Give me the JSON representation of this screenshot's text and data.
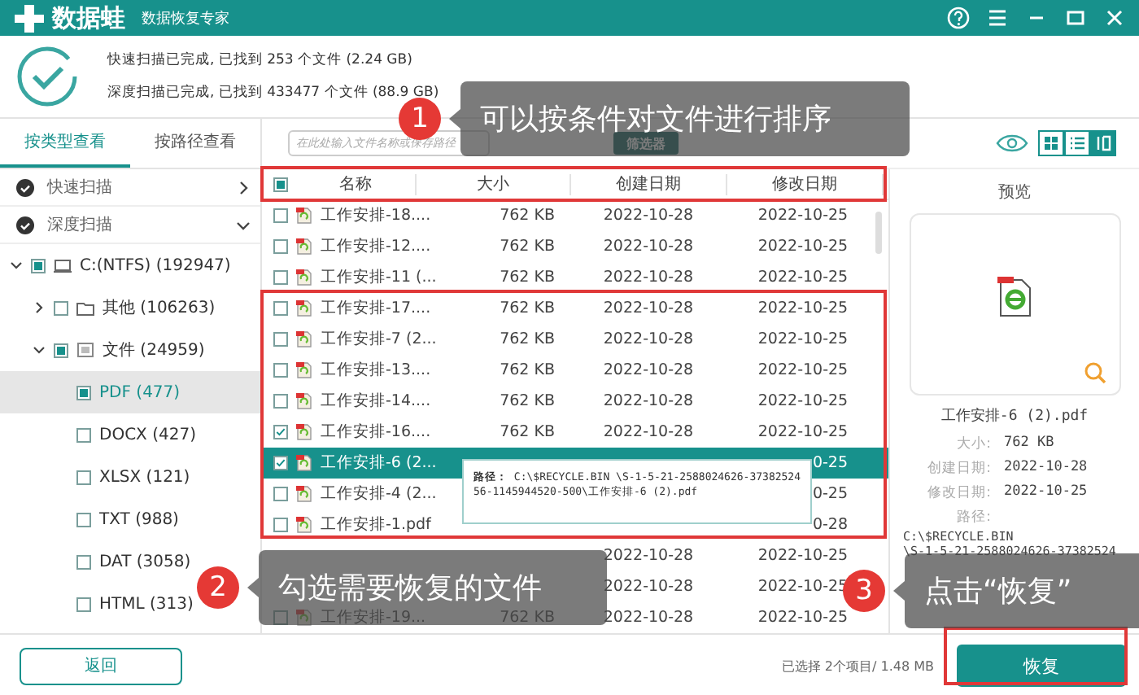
{
  "window": {
    "app_name": "数据蛙",
    "subtitle": "数据恢复专家"
  },
  "title_buttons": [
    {
      "kind": "help"
    },
    {
      "kind": "menu"
    },
    {
      "kind": "minimize"
    },
    {
      "kind": "maximize"
    },
    {
      "kind": "close"
    }
  ],
  "scan_summary": [
    "快速扫描已完成, 已找到 253 个文件 (2.24 GB)",
    "深度扫描已完成, 已找到 433477 个文件 (88.9 GB)"
  ],
  "view_tabs": [
    {
      "label": "按类型查看",
      "selected": true
    },
    {
      "label": "按路径查看",
      "selected": false
    }
  ],
  "scans": [
    {
      "label": "快速扫描",
      "expanded": false
    },
    {
      "label": "深度扫描",
      "expanded": true
    }
  ],
  "tree": [
    {
      "label": "C:(NTFS) (192947)",
      "kind": "drive",
      "checked": true,
      "expanded": true,
      "selected": false,
      "children": [
        {
          "label": "其他 (106263)",
          "kind": "folder",
          "checked": false,
          "expanded": false,
          "selected": false
        },
        {
          "label": "文件 (24959)",
          "kind": "files",
          "checked": true,
          "expanded": true,
          "selected": false,
          "children": [
            {
              "label": "PDF (477)",
              "checked": true,
              "selected": true
            },
            {
              "label": "DOCX (427)",
              "checked": false,
              "selected": false
            },
            {
              "label": "XLSX (121)",
              "checked": false,
              "selected": false
            },
            {
              "label": "TXT (988)",
              "checked": false,
              "selected": false
            },
            {
              "label": "DAT (3058)",
              "checked": false,
              "selected": false
            },
            {
              "label": "HTML (313)",
              "checked": false,
              "selected": false
            }
          ]
        }
      ]
    }
  ],
  "search": {
    "placeholder": "在此处输入文件名称或保存路径"
  },
  "filter_button": "筛选器",
  "view_modes": [
    {
      "kind": "grid",
      "selected": false
    },
    {
      "kind": "list",
      "selected": false
    },
    {
      "kind": "detail",
      "selected": true
    }
  ],
  "table": {
    "header_checkbox": {
      "checked": true
    },
    "columns": [
      "名称",
      "大小",
      "创建日期",
      "修改日期"
    ],
    "rows": [
      {
        "name": "工作安排-18....",
        "size": "762 KB",
        "created": "2022-10-28",
        "modified": "2022-10-25",
        "checked": false,
        "selected": false
      },
      {
        "name": "工作安排-12....",
        "size": "762 KB",
        "created": "2022-10-28",
        "modified": "2022-10-25",
        "checked": false,
        "selected": false
      },
      {
        "name": "工作安排-11 (...",
        "size": "762 KB",
        "created": "2022-10-28",
        "modified": "2022-10-25",
        "checked": false,
        "selected": false
      },
      {
        "name": "工作安排-17....",
        "size": "762 KB",
        "created": "2022-10-28",
        "modified": "2022-10-25",
        "checked": false,
        "selected": false
      },
      {
        "name": "工作安排-7 (2...",
        "size": "762 KB",
        "created": "2022-10-28",
        "modified": "2022-10-25",
        "checked": false,
        "selected": false
      },
      {
        "name": "工作安排-13....",
        "size": "762 KB",
        "created": "2022-10-28",
        "modified": "2022-10-25",
        "checked": false,
        "selected": false
      },
      {
        "name": "工作安排-14....",
        "size": "762 KB",
        "created": "2022-10-28",
        "modified": "2022-10-25",
        "checked": false,
        "selected": false
      },
      {
        "name": "工作安排-16....",
        "size": "762 KB",
        "created": "2022-10-28",
        "modified": "2022-10-25",
        "checked": true,
        "selected": false
      },
      {
        "name": "工作安排-6 (2...",
        "modified": "0-25",
        "checked": true,
        "selected": true
      },
      {
        "name": "工作安排-4 (2...",
        "modified": "0-25",
        "checked": false,
        "selected": false
      },
      {
        "name": "工作安排-1.pdf",
        "modified": "0-28",
        "checked": false,
        "selected": false
      },
      {
        "created": "2022-10-28",
        "modified": "2022-10-25",
        "selected": false
      },
      {
        "created": "2022-10-28",
        "modified": "2022-10-25",
        "selected": false
      },
      {
        "name": "工作安排-19...",
        "size": "762 KB",
        "created": "2022-10-28",
        "modified": "2022-10-25",
        "checked": false,
        "selected": false
      }
    ]
  },
  "tooltip": "**路径：** C:\\$RECYCLE.BIN \\S-1-5-21-2588024626-3738252456-1145944520-500\\工作安排-6 (2).pdf",
  "preview": {
    "title": "预览",
    "filename": "工作安排-6 (2).pdf",
    "details": [
      {
        "label": "大小:",
        "value": "762 KB"
      },
      {
        "label": "创建日期:",
        "value": "2022-10-28"
      },
      {
        "label": "修改日期:",
        "value": "2022-10-25"
      },
      {
        "label": "路径:"
      }
    ],
    "path_lines": [
      "C:\\$RECYCLE.BIN",
      "\\S-1-5-21-2588024626-37382524"
    ]
  },
  "bottom": {
    "back_button": "返回",
    "status": "已选择 2个项目/ 1.48 MB",
    "recover_button": "恢复"
  },
  "callouts": [
    {
      "number": "1",
      "text": "可以按条件对文件进行排序"
    },
    {
      "number": "2",
      "text": "勾选需要恢复的文件"
    },
    {
      "number": "3",
      "text": "点击“恢复”"
    }
  ]
}
